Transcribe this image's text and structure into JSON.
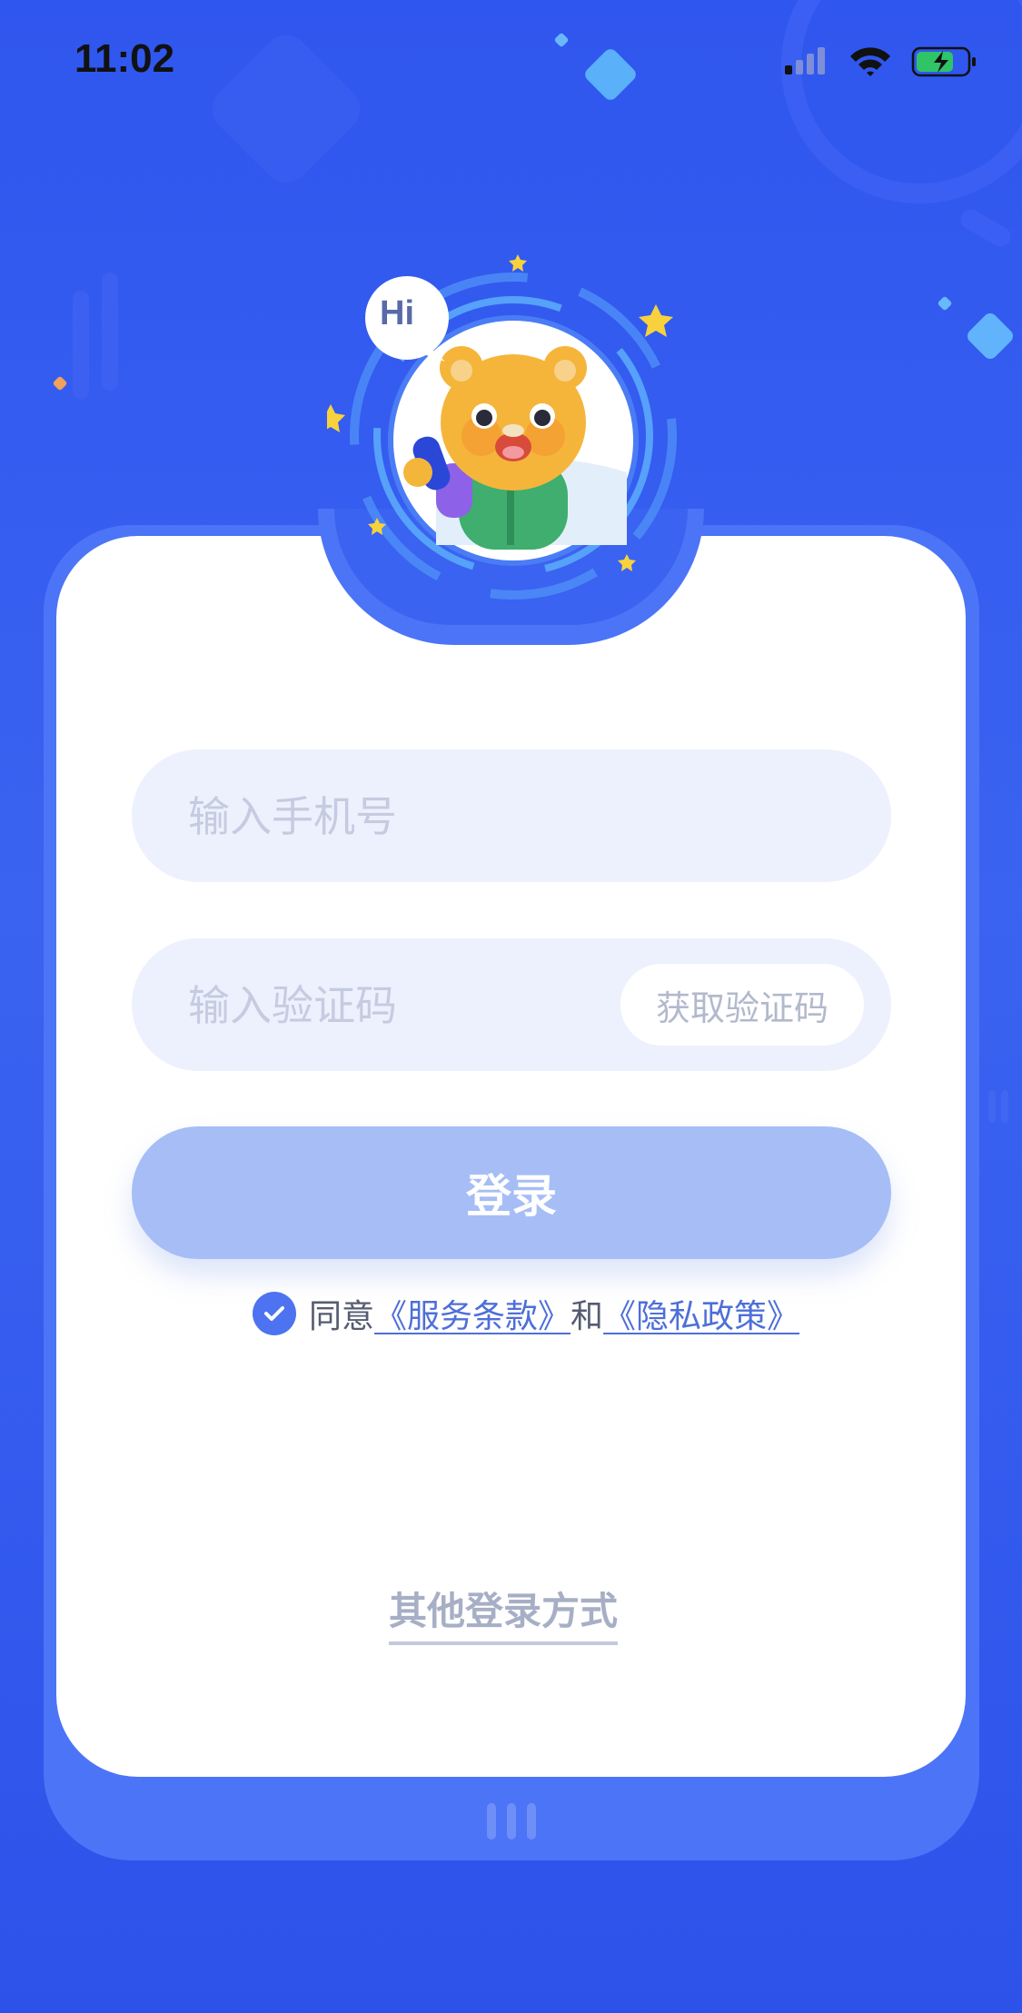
{
  "status_bar": {
    "time": "11:02"
  },
  "mascot": {
    "speech": "Hi"
  },
  "form": {
    "phone_placeholder": "输入手机号",
    "code_placeholder": "输入验证码",
    "get_code_label": "获取验证码",
    "login_label": "登录"
  },
  "agreement": {
    "prefix": "同意",
    "terms_link": "《服务条款》",
    "conjunction": "和",
    "privacy_link": "《隐私政策》",
    "checked": true
  },
  "other_login_label": "其他登录方式",
  "colors": {
    "background": "#2f56ee",
    "card": "#ffffff",
    "input_bg": "#edf1fd",
    "login_button": "#a6bdf6",
    "link": "#4e6fd8",
    "check": "#4d73f0"
  }
}
